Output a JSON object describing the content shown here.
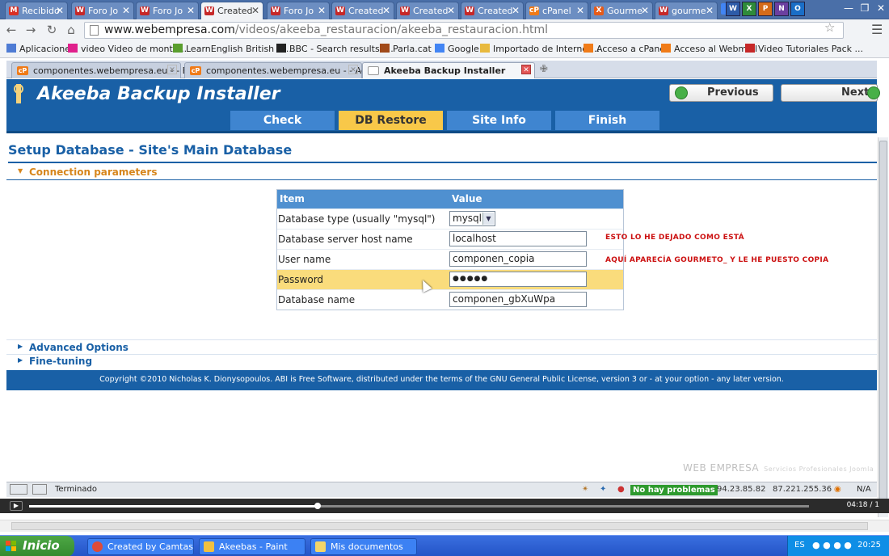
{
  "browser": {
    "tabs": [
      {
        "label": "Recibido",
        "fav": "M",
        "fav_color": "#d93025",
        "active": false
      },
      {
        "label": "Foro Jo",
        "fav": "W",
        "fav_color": "#c62828",
        "active": false
      },
      {
        "label": "Foro Jo",
        "fav": "W",
        "fav_color": "#c62828",
        "active": false
      },
      {
        "label": "Created",
        "fav": "W",
        "fav_color": "#c62828",
        "active": true
      },
      {
        "label": "Foro Jo",
        "fav": "W",
        "fav_color": "#c62828",
        "active": false
      },
      {
        "label": "Created",
        "fav": "W",
        "fav_color": "#c62828",
        "active": false
      },
      {
        "label": "Created",
        "fav": "W",
        "fav_color": "#c62828",
        "active": false
      },
      {
        "label": "Created",
        "fav": "W",
        "fav_color": "#c62828",
        "active": false
      },
      {
        "label": "cPanel",
        "fav": "cP",
        "fav_color": "#f07b18",
        "active": false
      },
      {
        "label": "Gourme",
        "fav": "X",
        "fav_color": "#e55b1a",
        "active": false
      },
      {
        "label": "gourme",
        "fav": "W",
        "fav_color": "#c62828",
        "active": false
      }
    ],
    "url_host": "www.webempresa.com",
    "url_path": "/videos/akeeba_restauracion/akeeba_restauracion.html",
    "bookmarks": [
      {
        "label": "Aplicaciones",
        "icon": "apps-icon",
        "color": "#4e7bd4"
      },
      {
        "label": "video Video de monta...",
        "icon": "flickr-icon",
        "color": "#e0208c"
      },
      {
        "label": "LearnEnglish British C...",
        "icon": "apps-icon",
        "color": "#5a9e2e"
      },
      {
        "label": "BBC - Search results f...",
        "icon": "bbc-icon",
        "color": "#222"
      },
      {
        "label": "Parla.cat",
        "icon": "person-icon",
        "color": "#a14a1a"
      },
      {
        "label": "Google",
        "icon": "google-icon",
        "color": "#4285f4"
      },
      {
        "label": "Importado de Internet...",
        "icon": "folder-icon",
        "color": "#e8b93d"
      },
      {
        "label": "Acceso a cPanel",
        "icon": "cpanel-icon",
        "color": "#f07b18"
      },
      {
        "label": "Acceso al Webmail",
        "icon": "cpanel-icon",
        "color": "#f07b18"
      },
      {
        "label": "Video Tutoriales Pack ...",
        "icon": "webempresa-icon",
        "color": "#c62828"
      }
    ]
  },
  "inner_tabs": [
    {
      "label": "componentes.webempresa.eu - - Base...",
      "active": false
    },
    {
      "label": "componentes.webempresa.eu - - Admi...",
      "active": false
    },
    {
      "label": "Akeeba Backup Installer",
      "active": true
    }
  ],
  "installer": {
    "title": "Akeeba Backup Installer",
    "previous_label": "Previous",
    "next_label": "Next",
    "steps": [
      {
        "label": "Check",
        "active": false
      },
      {
        "label": "DB Restore",
        "active": true
      },
      {
        "label": "Site Info",
        "active": false
      },
      {
        "label": "Finish",
        "active": false
      }
    ],
    "heading": "Setup Database - Site's Main Database",
    "section_connection": "Connection parameters",
    "section_advanced": "Advanced Options",
    "section_finetuning": "Fine-tuning",
    "table": {
      "col_item": "Item",
      "col_value": "Value",
      "rows": [
        {
          "label": "Database type (usually \"mysql\")",
          "value": "mysql",
          "kind": "select"
        },
        {
          "label": "Database server host name",
          "value": "localhost",
          "kind": "input"
        },
        {
          "label": "User name",
          "value": "componen_copia",
          "kind": "input"
        },
        {
          "label": "Password",
          "value": "●●●●●",
          "kind": "password"
        },
        {
          "label": "Database name",
          "value": "componen_gbXuWpa",
          "kind": "input"
        }
      ]
    },
    "note_host": "ESTO LO HE DEJADO COMO ESTÁ",
    "note_user": "AQUÍ APARECÍA GOURMETO_ Y LE HE PUESTO COPIA",
    "footer": "Copyright ©2010 Nicholas K. Dionysopoulos. ABI is Free Software, distributed under the terms of the GNU General Public License, version 3 or - at your option - any later version."
  },
  "watermark": {
    "brand": "WEB EMPRESA",
    "tagline": "Servicios Profesionales Joomla"
  },
  "statusbar": {
    "text": "Terminado",
    "health": "No hay problemas",
    "ip1": "94.23.85.82",
    "ip2": "87.221.255.36",
    "na": "N/A"
  },
  "player": {
    "time": "04:18 / 1",
    "progress": 0.37
  },
  "taskbar": {
    "start": "Inicio",
    "tasks": [
      {
        "label": "Created by Camtasia ...",
        "color": "#dd4b39"
      },
      {
        "label": "Akeebas - Paint",
        "color": "#f0c040"
      },
      {
        "label": "Mis documentos",
        "color": "#f3d56a"
      }
    ],
    "lang": "ES",
    "clock": "20:25"
  }
}
